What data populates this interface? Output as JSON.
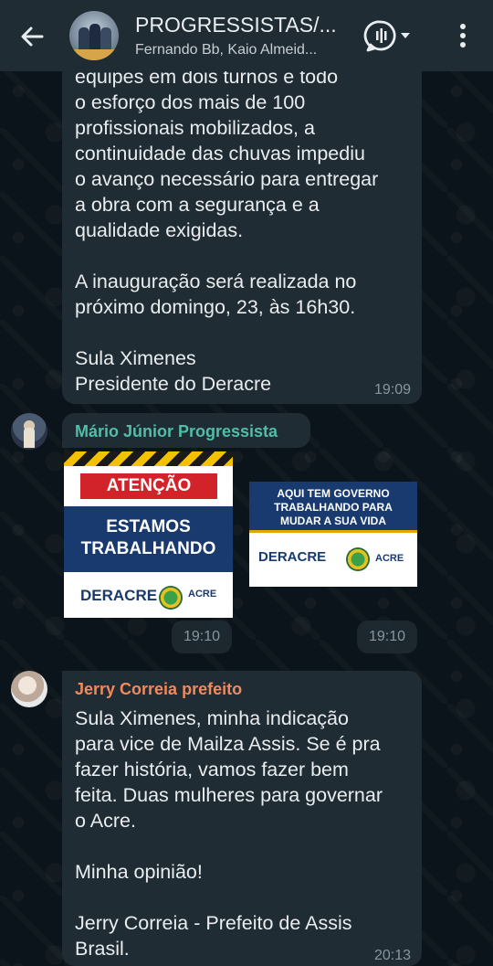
{
  "header": {
    "title": "PROGRESSISTAS/...",
    "subtitle": "Fernando Bb, Kaio Almeid..."
  },
  "messages": [
    {
      "text": "equipes em dois turnos e todo\no esforço dos mais de 100\nprofissionais mobilizados, a\ncontinuidade das chuvas impediu\no avanço necessário para entregar\na obra com a segurança e a\nqualidade exigidas.\n\nA inauguração será realizada no\npróximo domingo, 23, às 16h30.\n\nSula Ximenes\nPresidente do Deracre",
      "time": "19:09"
    },
    {
      "sender": "Mário Júnior Progressista",
      "images": [
        {
          "banner": "ATENÇÃO",
          "line1": "ESTAMOS",
          "line2": "TRABALHANDO",
          "logo": "DERACRE",
          "seal_label": "ACRE",
          "time": "19:10"
        },
        {
          "line1": "AQUI TEM GOVERNO",
          "line2": "TRABALHANDO PARA",
          "line3": "MUDAR A SUA VIDA",
          "logo": "DERACRE",
          "seal_label": "ACRE",
          "time": "19:10"
        }
      ]
    },
    {
      "sender": "Jerry Correia prefeito",
      "text": "Sula Ximenes, minha indicação\npara vice de Mailza Assis. Se é pra\nfazer história, vamos fazer bem\nfeita. Duas mulheres para governar\no Acre.\n\nMinha opinião!\n\nJerry Correia - Prefeito de Assis\nBrasil.",
      "time": "20:13"
    }
  ],
  "colors": {
    "header_bg": "#1f2c34",
    "bubble_bg": "#202c33",
    "sender_mario": "#53bdaa",
    "sender_jerry": "#f1895c"
  },
  "icons": [
    "back-arrow-icon",
    "call-icon",
    "more-vert-icon"
  ]
}
